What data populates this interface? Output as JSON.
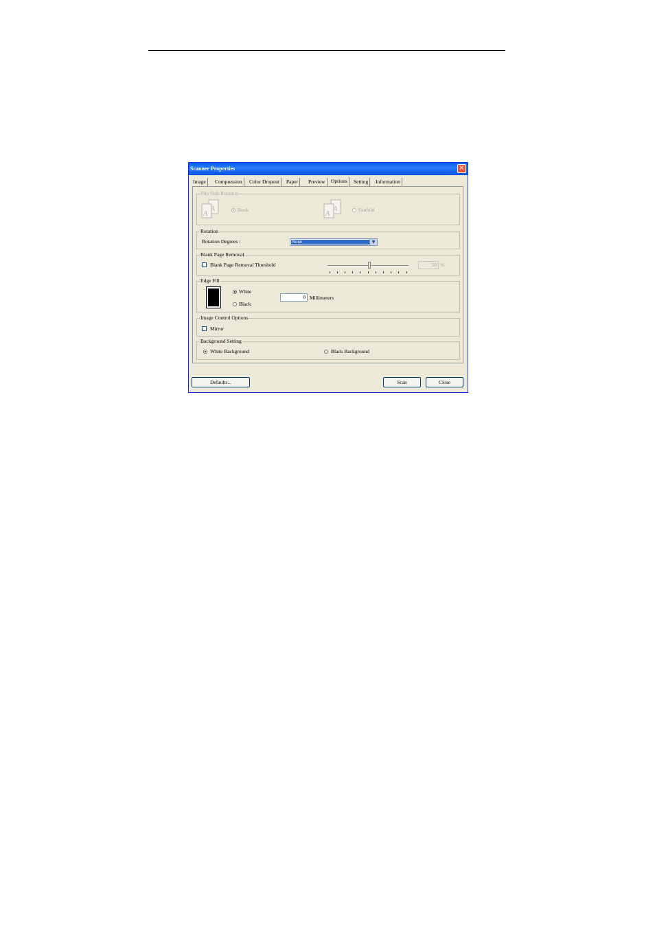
{
  "dialog": {
    "title": "Scanner Properties"
  },
  "tabs": [
    "Image",
    "Compression",
    "Color Dropout",
    "Paper",
    "Preview",
    "Options",
    "Setting",
    "Information"
  ],
  "active_tab": "Options",
  "flip_side_rotation": {
    "label": "Flip Side Rotation",
    "options": [
      "Book",
      "Fanfold"
    ],
    "selected": "Book",
    "icon_letter": "A"
  },
  "rotation": {
    "label": "Rotation",
    "degrees_label": "Rotation Degrees :",
    "selected": "None"
  },
  "blank_page_removal": {
    "label": "Blank Page Removal",
    "threshold_label": "Blank Page Removal Threshold",
    "checked": false,
    "threshold_value": "50",
    "unit": "%"
  },
  "edge_fill": {
    "label": "Edge Fill",
    "options": [
      "White",
      "Black"
    ],
    "selected": "White",
    "value": "0",
    "unit": "Millimeters"
  },
  "image_control": {
    "label": "Image Control Options",
    "mirror_label": "Mirror",
    "mirror_checked": false
  },
  "background_setting": {
    "label": "Background Setting",
    "options": [
      "White Background",
      "Black Background"
    ],
    "selected": "White Background"
  },
  "buttons": {
    "defaults": "Defaults...",
    "scan": "Scan",
    "close": "Close"
  }
}
